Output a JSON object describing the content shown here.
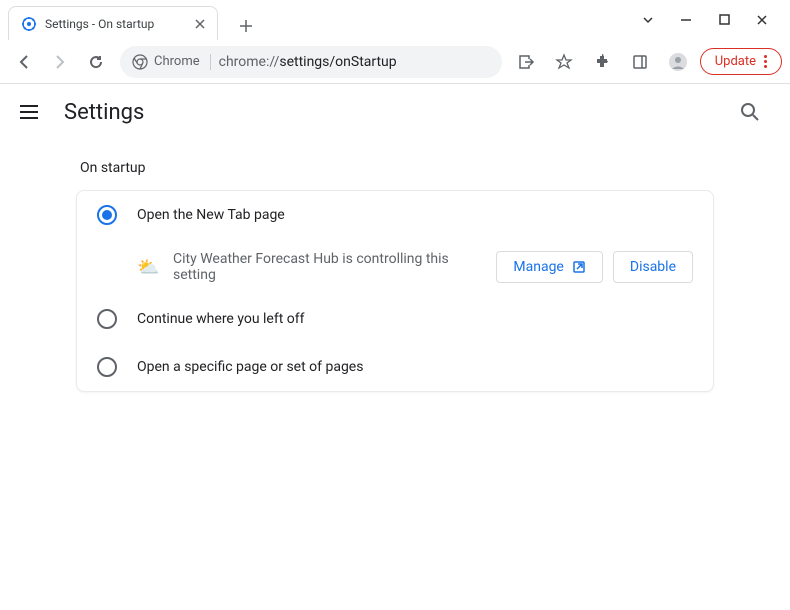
{
  "window": {
    "tab_title": "Settings - On startup"
  },
  "addressbar": {
    "chip_label": "Chrome",
    "url_prefix": "chrome://",
    "url_path": "settings/onStartup",
    "update_label": "Update"
  },
  "header": {
    "title": "Settings"
  },
  "section": {
    "title": "On startup",
    "options": [
      {
        "label": "Open the New Tab page"
      },
      {
        "label": "Continue where you left off"
      },
      {
        "label": "Open a specific page or set of pages"
      }
    ],
    "extension": {
      "message": "City Weather Forecast Hub is controlling this setting",
      "manage_label": "Manage",
      "disable_label": "Disable"
    }
  }
}
